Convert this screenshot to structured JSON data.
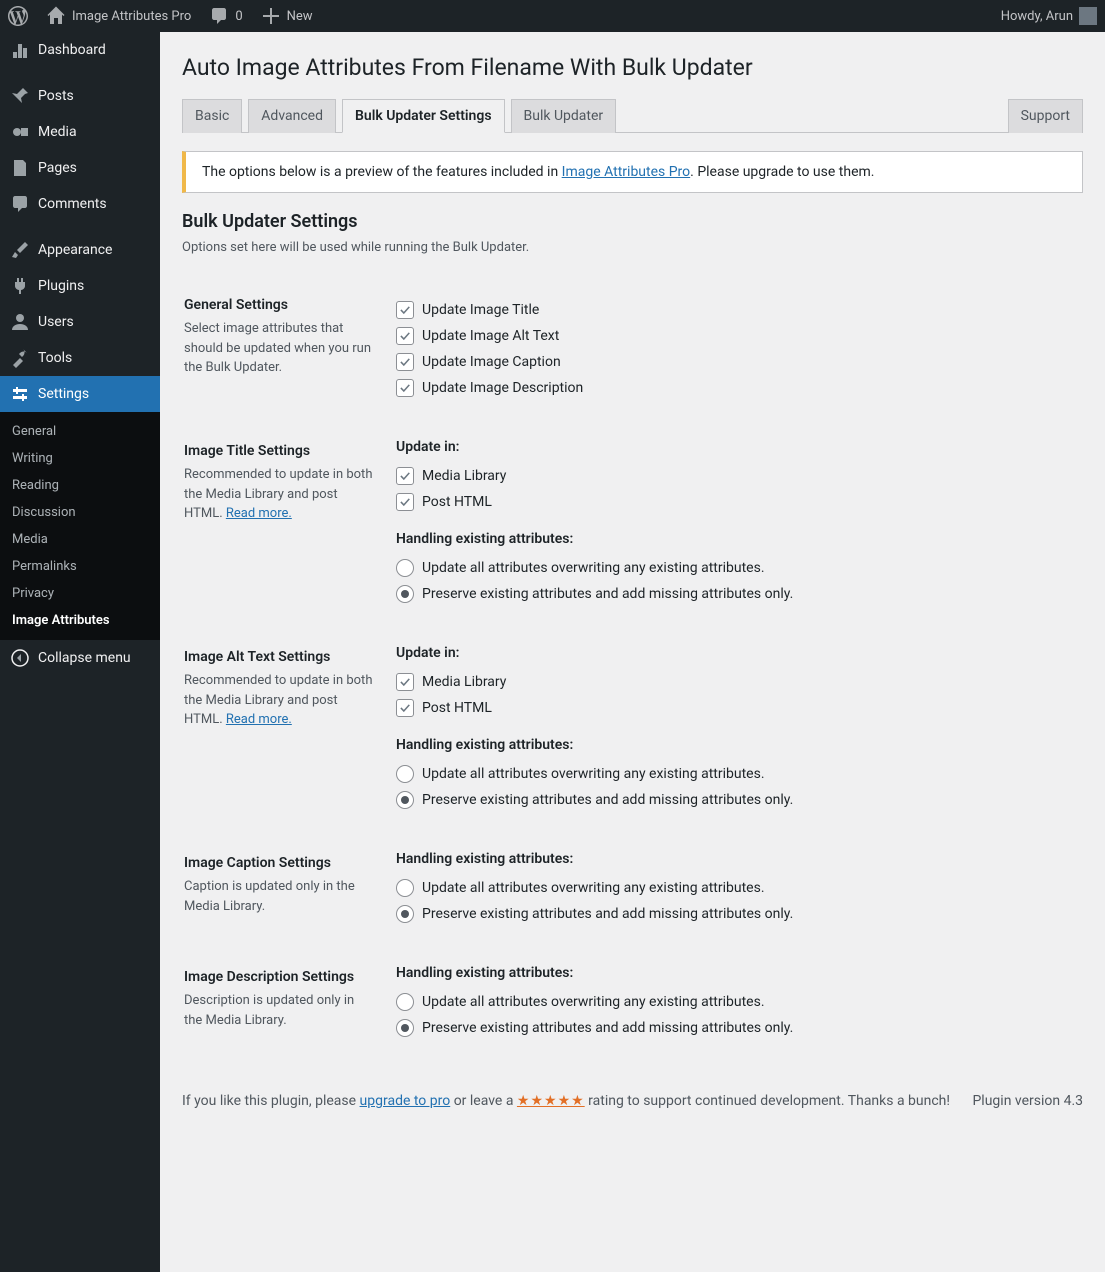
{
  "adminbar": {
    "site_name": "Image Attributes Pro",
    "comments_count": "0",
    "new_label": "New",
    "howdy": "Howdy, Arun"
  },
  "sidebar": {
    "items": [
      {
        "label": "Dashboard"
      },
      {
        "label": "Posts"
      },
      {
        "label": "Media"
      },
      {
        "label": "Pages"
      },
      {
        "label": "Comments"
      },
      {
        "label": "Appearance"
      },
      {
        "label": "Plugins"
      },
      {
        "label": "Users"
      },
      {
        "label": "Tools"
      },
      {
        "label": "Settings"
      }
    ],
    "submenu": [
      {
        "label": "General"
      },
      {
        "label": "Writing"
      },
      {
        "label": "Reading"
      },
      {
        "label": "Discussion"
      },
      {
        "label": "Media"
      },
      {
        "label": "Permalinks"
      },
      {
        "label": "Privacy"
      },
      {
        "label": "Image Attributes"
      }
    ],
    "collapse": "Collapse menu"
  },
  "page": {
    "title": "Auto Image Attributes From Filename With Bulk Updater",
    "tabs": [
      "Basic",
      "Advanced",
      "Bulk Updater Settings",
      "Bulk Updater",
      "Support"
    ],
    "notice_prefix": "The options below is a preview of the features included in ",
    "notice_link": "Image Attributes Pro",
    "notice_suffix": ". Please upgrade to use them.",
    "section_heading": "Bulk Updater Settings",
    "section_desc": "Options set here will be used while running the Bulk Updater."
  },
  "sections": {
    "general": {
      "title": "General Settings",
      "hint": "Select image attributes that should be updated when you run the Bulk Updater.",
      "options": [
        "Update Image Title",
        "Update Image Alt Text",
        "Update Image Caption",
        "Update Image Description"
      ]
    },
    "title_s": {
      "title": "Image Title Settings",
      "hint": "Recommended to update in both the Media Library and post HTML. ",
      "read_more": "Read more.",
      "update_in_label": "Update in:",
      "update_in": [
        "Media Library",
        "Post HTML"
      ],
      "handling_label": "Handling existing attributes:",
      "radios": [
        "Update all attributes overwriting any existing attributes.",
        "Preserve existing attributes and add missing attributes only."
      ]
    },
    "alt_s": {
      "title": "Image Alt Text Settings",
      "hint": "Recommended to update in both the Media Library and post HTML. ",
      "read_more": "Read more.",
      "update_in_label": "Update in:",
      "update_in": [
        "Media Library",
        "Post HTML"
      ],
      "handling_label": "Handling existing attributes:",
      "radios": [
        "Update all attributes overwriting any existing attributes.",
        "Preserve existing attributes and add missing attributes only."
      ]
    },
    "caption_s": {
      "title": "Image Caption Settings",
      "hint": "Caption is updated only in the Media Library.",
      "handling_label": "Handling existing attributes:",
      "radios": [
        "Update all attributes overwriting any existing attributes.",
        "Preserve existing attributes and add missing attributes only."
      ]
    },
    "desc_s": {
      "title": "Image Description Settings",
      "hint": "Description is updated only in the Media Library.",
      "handling_label": "Handling existing attributes:",
      "radios": [
        "Update all attributes overwriting any existing attributes.",
        "Preserve existing attributes and add missing attributes only."
      ]
    }
  },
  "footer": {
    "prefix": "If you like this plugin, please ",
    "upgrade": "upgrade to pro",
    "mid": " or leave a ",
    "stars": "★★★★★",
    "suffix": " rating to support continued development. Thanks a bunch!",
    "version": "Plugin version 4.3"
  }
}
